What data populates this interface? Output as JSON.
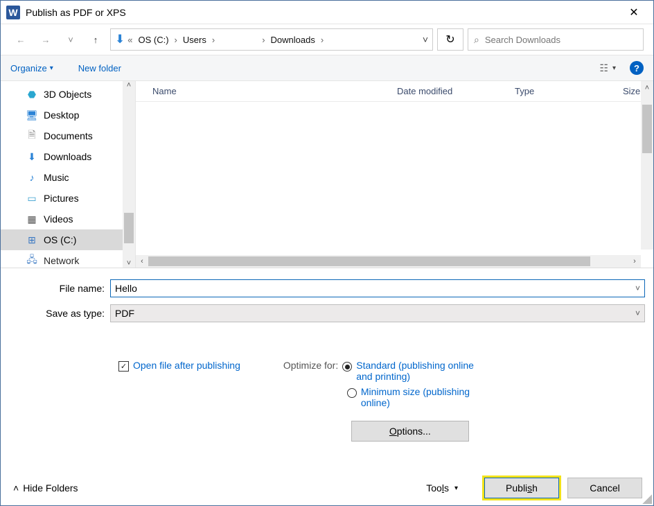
{
  "window": {
    "title": "Publish as PDF or XPS"
  },
  "nav": {
    "crumb1": "OS (C:)",
    "crumb2": "Users",
    "crumb3": "Downloads"
  },
  "search": {
    "placeholder": "Search Downloads"
  },
  "toolbar": {
    "organize": "Organize",
    "new_folder": "New folder"
  },
  "sidebar": {
    "items": [
      {
        "label": "3D Objects",
        "icon": "🧊"
      },
      {
        "label": "Desktop",
        "icon": "🖥"
      },
      {
        "label": "Documents",
        "icon": "📄"
      },
      {
        "label": "Downloads",
        "icon": "⬇"
      },
      {
        "label": "Music",
        "icon": "♪"
      },
      {
        "label": "Pictures",
        "icon": "🖼"
      },
      {
        "label": "Videos",
        "icon": "🎞"
      },
      {
        "label": "OS (C:)",
        "icon": "💽"
      },
      {
        "label": "Network",
        "icon": "🖧"
      }
    ]
  },
  "columns": {
    "name": "Name",
    "date": "Date modified",
    "type": "Type",
    "size": "Size"
  },
  "form": {
    "filename_label": "File name:",
    "filename_value": "Hello",
    "saveas_label": "Save as type:",
    "saveas_value": "PDF",
    "open_after": "Open file after publishing",
    "optimize_for": "Optimize for:",
    "opt_standard": "Standard (publishing online and printing)",
    "opt_min": "Minimum size (publishing online)",
    "options_btn": "Options..."
  },
  "footer": {
    "hide_folders": "Hide Folders",
    "tools": "Tools",
    "publish": "Publish",
    "cancel": "Cancel"
  }
}
